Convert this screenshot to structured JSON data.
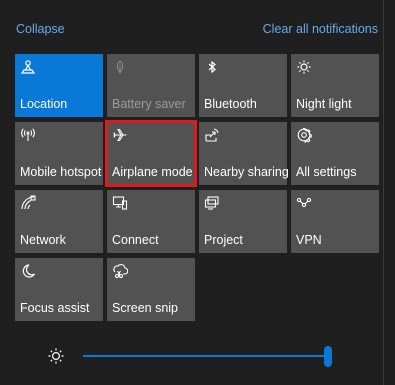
{
  "header": {
    "collapse_label": "Collapse",
    "clear_label": "Clear all notifications"
  },
  "tiles": [
    {
      "label": "Location",
      "icon": "location-icon",
      "state": "on"
    },
    {
      "label": "Battery saver",
      "icon": "battery-saver-icon",
      "state": "disabled"
    },
    {
      "label": "Bluetooth",
      "icon": "bluetooth-icon",
      "state": "off"
    },
    {
      "label": "Night light",
      "icon": "night-light-icon",
      "state": "off"
    },
    {
      "label": "Mobile hotspot",
      "icon": "mobile-hotspot-icon",
      "state": "off"
    },
    {
      "label": "Airplane mode",
      "icon": "airplane-icon",
      "state": "off",
      "highlighted": true
    },
    {
      "label": "Nearby sharing",
      "icon": "nearby-sharing-icon",
      "state": "off"
    },
    {
      "label": "All settings",
      "icon": "gear-icon",
      "state": "off"
    },
    {
      "label": "Network",
      "icon": "network-icon",
      "state": "off"
    },
    {
      "label": "Connect",
      "icon": "connect-icon",
      "state": "off"
    },
    {
      "label": "Project",
      "icon": "project-icon",
      "state": "off"
    },
    {
      "label": "VPN",
      "icon": "vpn-icon",
      "state": "off"
    },
    {
      "label": "Focus assist",
      "icon": "moon-icon",
      "state": "off"
    },
    {
      "label": "Screen snip",
      "icon": "screen-snip-icon",
      "state": "off"
    }
  ],
  "brightness": {
    "icon": "brightness-icon",
    "level": 1.0
  },
  "colors": {
    "accent": "#0a78d7",
    "tile_background": "#525252",
    "panel_background": "#1f1f1f",
    "link": "#62acee",
    "highlight_box": "#e0191f"
  }
}
